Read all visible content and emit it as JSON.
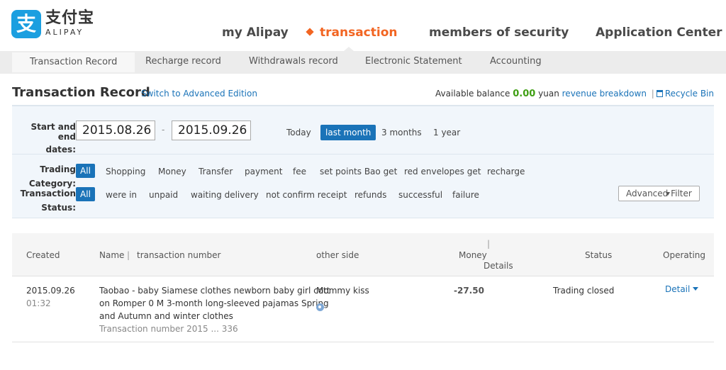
{
  "brand": {
    "logo_glyph": "支",
    "logo_cn": "支付宝",
    "logo_en": "ALIPAY",
    "color": "#1b9fe0"
  },
  "main_nav": {
    "items": [
      {
        "label": "my Alipay"
      },
      {
        "label": "transaction",
        "active": true
      },
      {
        "label": "members of security"
      },
      {
        "label": "Application Center"
      }
    ],
    "active_color": "#f26522"
  },
  "sub_nav": {
    "items": [
      {
        "label": "Transaction Record",
        "active": true
      },
      {
        "label": "Recharge record"
      },
      {
        "label": "Withdrawals record"
      },
      {
        "label": "Electronic Statement"
      },
      {
        "label": "Accounting"
      }
    ]
  },
  "page": {
    "title": "Transaction Record",
    "advanced_link": "Switch to Advanced Edition",
    "balance_label": "Available balance",
    "balance_amount": "0.00",
    "balance_unit": "yuan",
    "revenue_link": "revenue breakdown",
    "separator": "|",
    "recycle_link": "Recycle Bin"
  },
  "filter": {
    "date_label_line1": "Start and end",
    "date_label_line2": "dates:",
    "start_date": "2015.08.26",
    "end_date": "2015.09.26",
    "date_dash": "-",
    "quick_ranges": [
      {
        "label": "Today"
      },
      {
        "label": "last month",
        "active": true
      },
      {
        "label": "3 months"
      },
      {
        "label": "1 year"
      }
    ],
    "category_label_line1": "Trading",
    "category_label_line2": "Category:",
    "category_all": "All",
    "categories": [
      "Shopping",
      "Money",
      "Transfer",
      "payment",
      "fee",
      "set points Bao get",
      "red envelopes get",
      "recharge"
    ],
    "status_label_line1": "Transaction",
    "status_label_line2": "Status:",
    "status_all": "All",
    "statuses": [
      "were in",
      "unpaid",
      "waiting delivery",
      "not confirm receipt",
      "refunds",
      "successful",
      "failure"
    ],
    "advanced_filter": "Advanced Filter"
  },
  "table": {
    "headers": {
      "created": "Created",
      "name": "Name",
      "name_sep": "|",
      "txn_number": "transaction number",
      "other_side": "other side",
      "money_sep": "|",
      "money": "Money",
      "details": "Details",
      "status": "Status",
      "operating": "Operating"
    },
    "rows": [
      {
        "date": "2015.09.26",
        "time": "01:32",
        "name_line1": "Taobao - baby Siamese clothes newborn baby girl cott",
        "name_line2": "on Romper 0 M 3-month long-sleeved pajamas Spring",
        "name_line3": "and Autumn and winter clothes",
        "txn": "Transaction number 2015 ... 336",
        "other_side": "Mommy kiss",
        "amount": "-27.50",
        "status": "Trading closed",
        "action": "Detail"
      }
    ]
  },
  "colors": {
    "accent": "#1a73b8",
    "balance": "#3f9f14",
    "filter_bg": "#f1f6fb",
    "subnav_bg": "#ececec"
  }
}
